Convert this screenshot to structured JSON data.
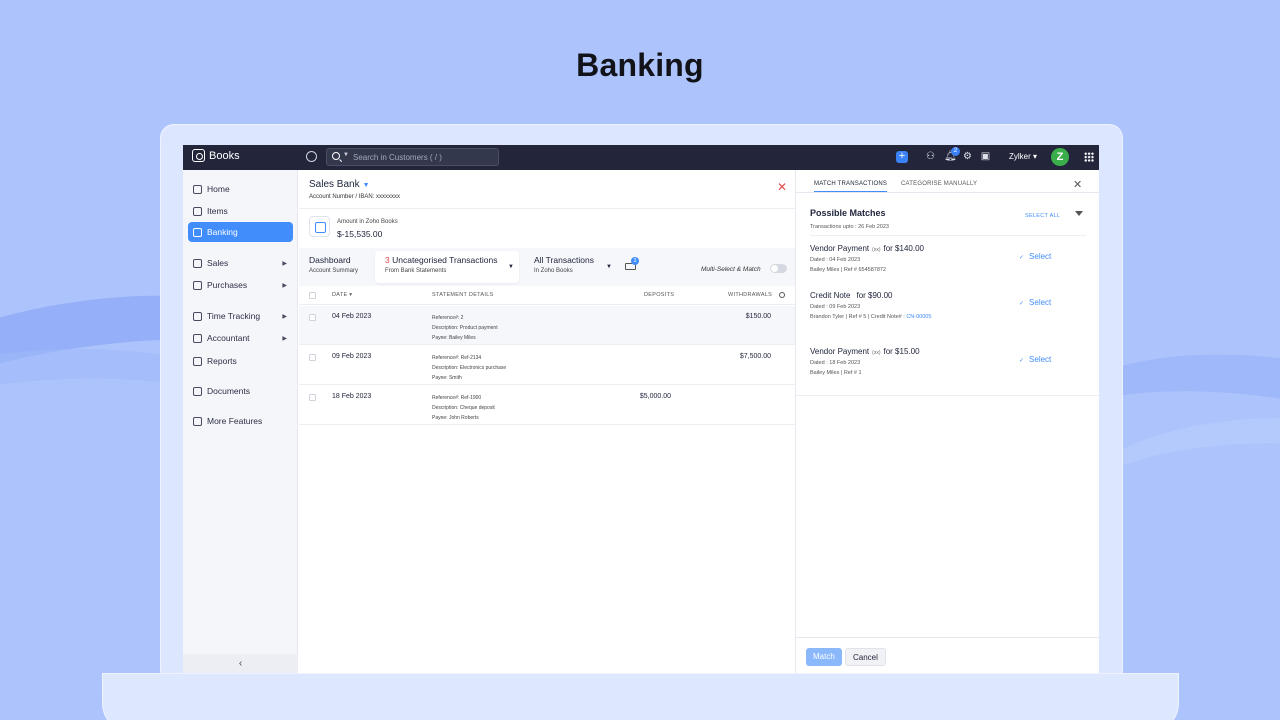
{
  "page": {
    "heading": "Banking"
  },
  "topbar": {
    "app_name": "Books",
    "search_placeholder": "Search in Customers ( / )",
    "notification_count": "2",
    "org_name": "Zylker",
    "avatar_initial": "Z"
  },
  "sidebar": {
    "items": [
      {
        "label": "Home",
        "icon": "home-icon"
      },
      {
        "label": "Items",
        "icon": "items-icon"
      },
      {
        "label": "Banking",
        "icon": "bank-icon",
        "active": true
      },
      {
        "label": "Sales",
        "icon": "cart-icon",
        "has_submenu": true
      },
      {
        "label": "Purchases",
        "icon": "bag-icon",
        "has_submenu": true
      },
      {
        "label": "Time Tracking",
        "icon": "timer-icon",
        "has_submenu": true
      },
      {
        "label": "Accountant",
        "icon": "user-icon",
        "has_submenu": true
      },
      {
        "label": "Reports",
        "icon": "chart-icon"
      },
      {
        "label": "Documents",
        "icon": "folder-icon"
      },
      {
        "label": "More Features",
        "icon": "star-icon"
      }
    ],
    "collapse_glyph": "‹"
  },
  "account": {
    "name": "Sales Bank",
    "subtitle": "Account Number / IBAN: xxxxxxxx",
    "balance_label": "Amount in Zoho Books",
    "balance_value": "$-15,535.00"
  },
  "tabs": {
    "dashboard": {
      "title": "Dashboard",
      "sub": "Account Summary"
    },
    "uncategorised": {
      "count": "3",
      "title": " Uncategorised Transactions",
      "sub": "From Bank Statements"
    },
    "all": {
      "title": "All Transactions",
      "sub": "In Zoho Books"
    },
    "rules_badge": "3",
    "multi_select_label": "Multi-Select & Match"
  },
  "table": {
    "headers": {
      "date": "DATE",
      "details": "STATEMENT DETAILS",
      "deposits": "DEPOSITS",
      "withdrawals": "WITHDRAWALS"
    },
    "rows": [
      {
        "date": "04 Feb 2023",
        "reference": "Reference#: 2",
        "description": "Description: Product payment",
        "payee": "Payee: Bailey Miles",
        "deposit": "",
        "withdrawal": "$150.00"
      },
      {
        "date": "09 Feb 2023",
        "reference": "Reference#: Ref-2134",
        "description": "Description: Electronics purchase",
        "payee": "Payee: Smith",
        "deposit": "",
        "withdrawal": "$7,500.00"
      },
      {
        "date": "18 Feb 2023",
        "reference": "Reference#: Ref-1900",
        "description": "Description: Cheque deposit",
        "payee": "Payee: John Roberts",
        "deposit": "$5,000.00",
        "withdrawal": ""
      }
    ]
  },
  "panel": {
    "tab_match": "MATCH TRANSACTIONS",
    "tab_categorise": "CATEGORISE MANUALLY",
    "title": "Possible Matches",
    "subtitle": "Transactions upto : 26 Feb 2023",
    "select_all": "SELECT ALL",
    "matches": [
      {
        "type": "Vendor Payment",
        "pill": "(xx)",
        "amount": "for $140.00",
        "dated": "Dated : 04 Feb 2023",
        "ref": "Bailey Miles | Ref # 654587872",
        "ref_link": ""
      },
      {
        "type": "Credit Note",
        "pill": "",
        "amount": "for $90.00",
        "dated": "Dated : 09 Feb 2023",
        "ref": "Brandon Tyler | Ref # 5 | Credit Note# :",
        "ref_link": "CN-00005"
      },
      {
        "type": "Vendor Payment",
        "pill": "(xx)",
        "amount": "for $15.00",
        "dated": "Dated : 18 Feb 2023",
        "ref": "Bailey Miles | Ref # 1",
        "ref_link": ""
      }
    ],
    "select_label": "Select",
    "match_button": "Match",
    "cancel_button": "Cancel"
  }
}
